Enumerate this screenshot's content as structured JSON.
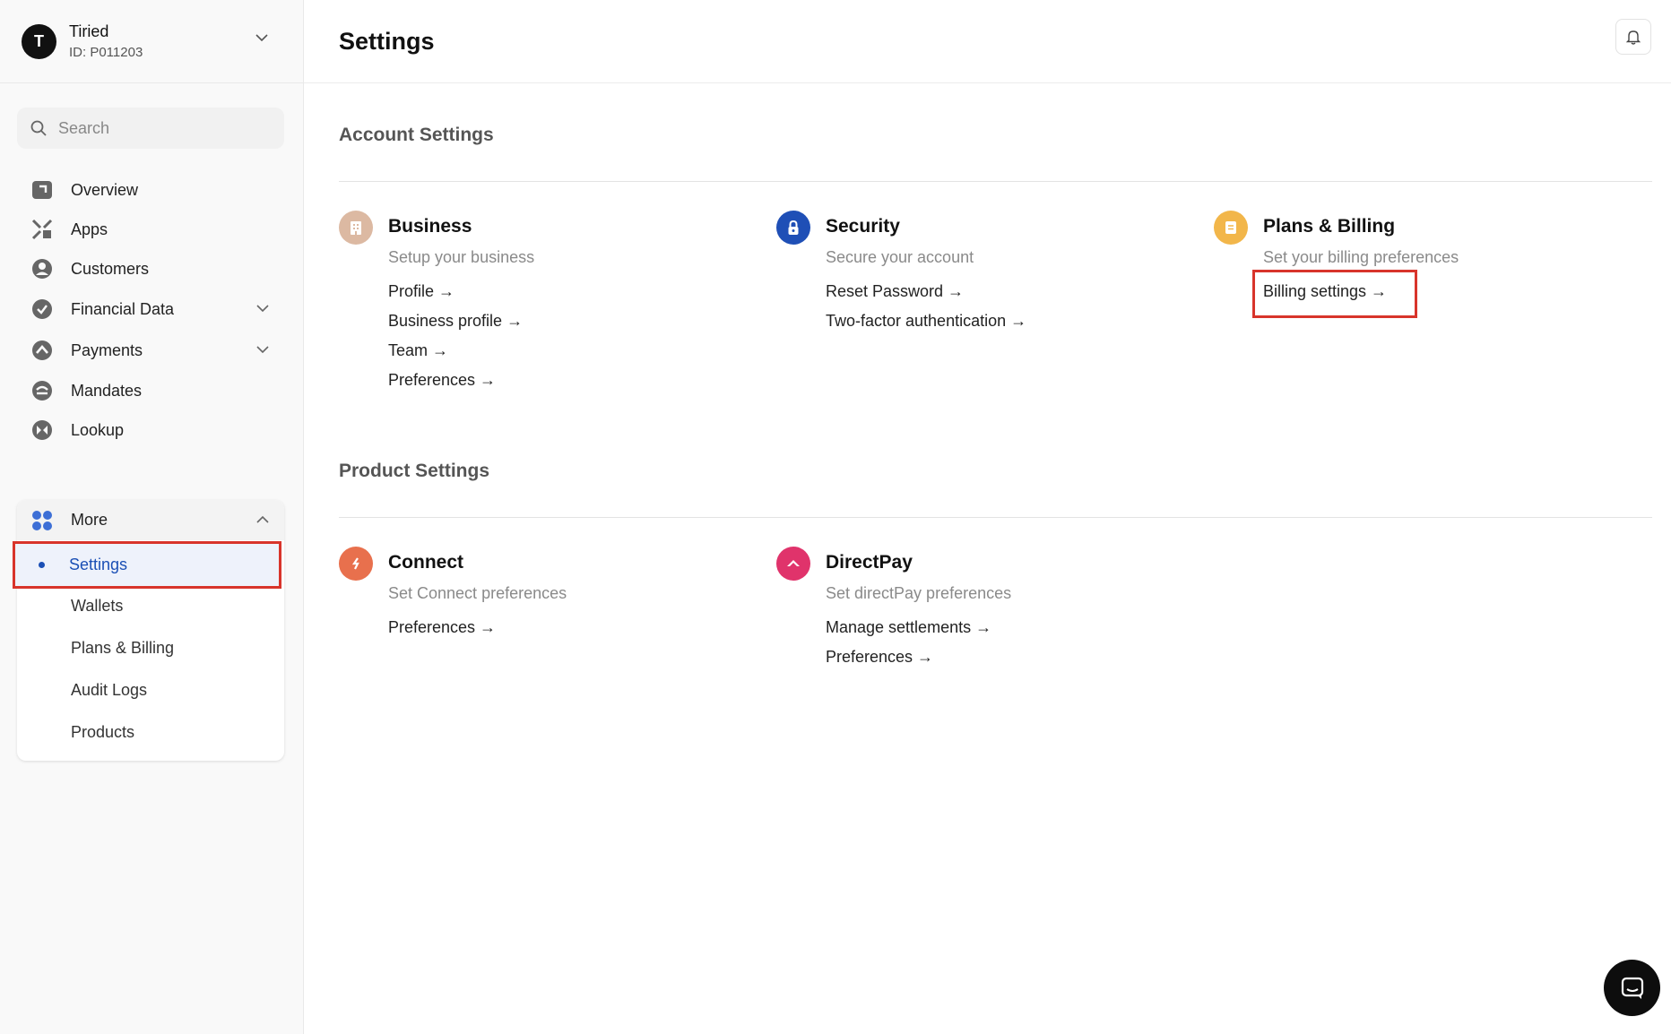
{
  "account": {
    "avatar_letter": "T",
    "name": "Tiried",
    "id": "ID: P011203"
  },
  "search": {
    "placeholder": "Search"
  },
  "nav": {
    "overview": "Overview",
    "apps": "Apps",
    "customers": "Customers",
    "financial_data": "Financial Data",
    "payments": "Payments",
    "mandates": "Mandates",
    "lookup": "Lookup",
    "more": "More",
    "more_items": {
      "settings": "Settings",
      "wallets": "Wallets",
      "plans_billing": "Plans & Billing",
      "audit_logs": "Audit Logs",
      "products": "Products"
    }
  },
  "header": {
    "title": "Settings"
  },
  "account_settings": {
    "title": "Account Settings",
    "business": {
      "title": "Business",
      "subtitle": "Setup your business",
      "links": [
        "Profile →",
        "Business profile →",
        "Team →",
        "Preferences →"
      ]
    },
    "security": {
      "title": "Security",
      "subtitle": "Secure your account",
      "links": [
        "Reset Password →",
        "Two-factor authentication →"
      ]
    },
    "plans_billing": {
      "title": "Plans & Billing",
      "subtitle": "Set your billing preferences",
      "links": [
        "Billing settings →"
      ]
    }
  },
  "product_settings": {
    "title": "Product Settings",
    "connect": {
      "title": "Connect",
      "subtitle": "Set Connect preferences",
      "links": [
        "Preferences →"
      ]
    },
    "directpay": {
      "title": "DirectPay",
      "subtitle": "Set directPay preferences",
      "links": [
        "Manage settlements →",
        "Preferences →"
      ]
    }
  },
  "colors": {
    "active_blue": "#1a4fb5",
    "highlight_red": "#d8342b",
    "business_icon": "#dcb9a2",
    "security_icon": "#1f4fb6",
    "billing_icon": "#f2b64a",
    "connect_icon": "#e8704d",
    "directpay_icon": "#e0336b"
  }
}
